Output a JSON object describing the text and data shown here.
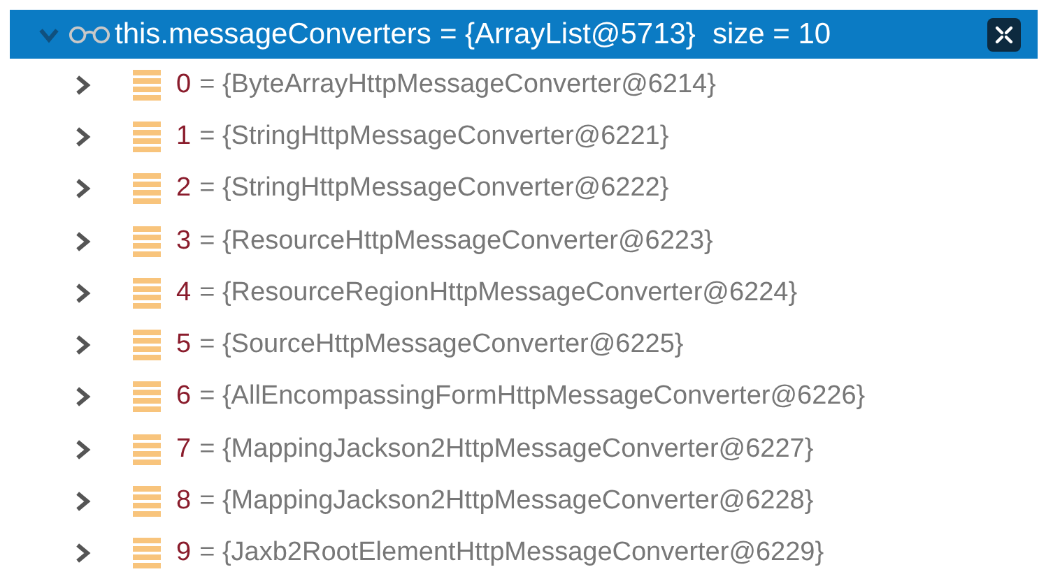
{
  "variable": {
    "name": "this.messageConverters",
    "value": "= {ArrayList@5713}",
    "size": "size = 10",
    "expanded": true,
    "selected": true
  },
  "children": [
    {
      "index": "0",
      "value": "= {ByteArrayHttpMessageConverter@6214}",
      "expanded": false
    },
    {
      "index": "1",
      "value": "= {StringHttpMessageConverter@6221}",
      "expanded": false
    },
    {
      "index": "2",
      "value": "= {StringHttpMessageConverter@6222}",
      "expanded": false
    },
    {
      "index": "3",
      "value": "= {ResourceHttpMessageConverter@6223}",
      "expanded": false
    },
    {
      "index": "4",
      "value": "= {ResourceRegionHttpMessageConverter@6224}",
      "expanded": false
    },
    {
      "index": "5",
      "value": "= {SourceHttpMessageConverter@6225}",
      "expanded": false
    },
    {
      "index": "6",
      "value": "= {AllEncompassingFormHttpMessageConverter@6226}",
      "expanded": false
    },
    {
      "index": "7",
      "value": "= {MappingJackson2HttpMessageConverter@6227}",
      "expanded": false
    },
    {
      "index": "8",
      "value": "= {MappingJackson2HttpMessageConverter@6228}",
      "expanded": false
    },
    {
      "index": "9",
      "value": "= {Jaxb2RootElementHttpMessageConverter@6229}",
      "expanded": false
    }
  ]
}
